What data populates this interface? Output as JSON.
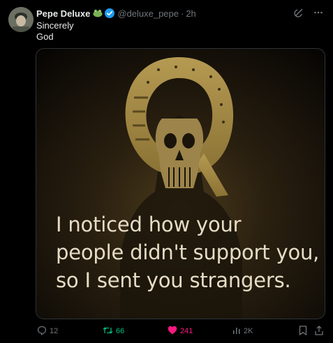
{
  "post": {
    "author_name": "Pepe Deluxe",
    "handle": "@deluxe_pepe",
    "separator": "·",
    "time": "2h",
    "text_line1": "Sincerely",
    "text_line2": "God"
  },
  "media": {
    "caption_line1": "I noticed how your",
    "caption_line2": "people didn't support you,",
    "caption_line3": "so I sent you strangers."
  },
  "actions": {
    "replies": "12",
    "reposts": "66",
    "likes": "241",
    "views": "2K"
  },
  "colors": {
    "background": "#000000",
    "muted": "#71767b",
    "repost_green": "#00ba7c",
    "like_pink": "#f91880",
    "verified_blue": "#1d9bf0"
  },
  "icons": [
    "emoji-frog-icon",
    "verified-badge-icon",
    "grok-icon",
    "more-icon",
    "reply-icon",
    "repost-icon",
    "like-icon",
    "views-icon",
    "bookmark-icon",
    "share-icon"
  ]
}
